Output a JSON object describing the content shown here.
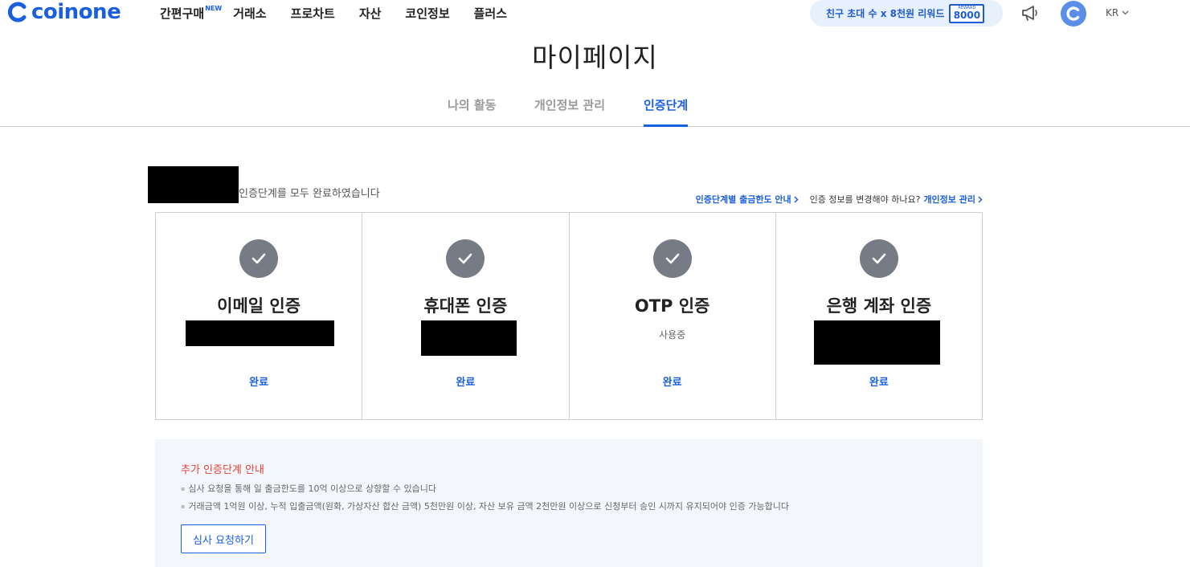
{
  "header": {
    "logo_text": "coinone",
    "nav": [
      {
        "label": "간편구매",
        "badge": "NEW"
      },
      {
        "label": "거래소"
      },
      {
        "label": "프로차트"
      },
      {
        "label": "자산"
      },
      {
        "label": "코인정보"
      },
      {
        "label": "플러스"
      }
    ],
    "invite": {
      "text": "친구 초대 수 x 8천원 리워드",
      "reward_label": "REWARD",
      "reward_value": "8000"
    },
    "lang": "KR"
  },
  "page_title": "마이페이지",
  "tabs": [
    {
      "label": "나의 활동",
      "active": false
    },
    {
      "label": "개인정보 관리",
      "active": false
    },
    {
      "label": "인증단계",
      "active": true
    }
  ],
  "status": {
    "text": "인증단계를 모두 완료하였습니다",
    "limit_link": "인증단계별 출금한도 안내",
    "change_prompt": "인증 정보를 변경해야 하나요?",
    "change_link": "개인정보 관리"
  },
  "cards": [
    {
      "title": "이메일 인증",
      "sub": "",
      "status": "완료"
    },
    {
      "title": "휴대폰 인증",
      "sub": "",
      "status": "완료"
    },
    {
      "title": "OTP 인증",
      "sub": "사용중",
      "status": "완료"
    },
    {
      "title": "은행 계좌 인증",
      "sub": "",
      "status": "완료"
    }
  ],
  "info": {
    "title": "추가 인증단계 안내",
    "lines": [
      "심사 요청을 통해 일 출금한도를 10억 이상으로 상향할 수 있습니다",
      "거래금액 1억원 이상, 누적 입출금액(원화, 가상자산 합산 금액) 5천만원 이상, 자산 보유 금액 2천만원 이상으로 신청부터 승인 시까지 유지되어야 인증 가능합니다"
    ],
    "button": "심사 요청하기"
  },
  "colors": {
    "brand": "#1a5fe0",
    "check_circle": "#767b85",
    "info_title": "#e0433a",
    "info_bg": "#f3f7fc"
  }
}
